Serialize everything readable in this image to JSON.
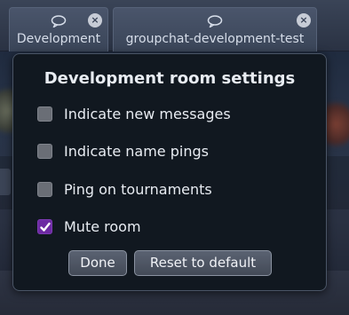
{
  "tabs": [
    {
      "label": "Development",
      "icon": "chat-bubble-icon",
      "close": "×"
    },
    {
      "label": "groupchat-development-test",
      "icon": "chat-bubble-icon",
      "close": "×"
    }
  ],
  "popup": {
    "title": "Development room settings",
    "options": [
      {
        "label": "Indicate new messages",
        "checked": false
      },
      {
        "label": "Indicate name pings",
        "checked": false
      },
      {
        "label": "Ping on tournaments",
        "checked": false
      },
      {
        "label": "Mute room",
        "checked": true
      }
    ],
    "buttons": {
      "done": "Done",
      "reset": "Reset to default"
    }
  },
  "colors": {
    "accent_checked": "#6d2aa3",
    "popup_bg": "#111820"
  }
}
